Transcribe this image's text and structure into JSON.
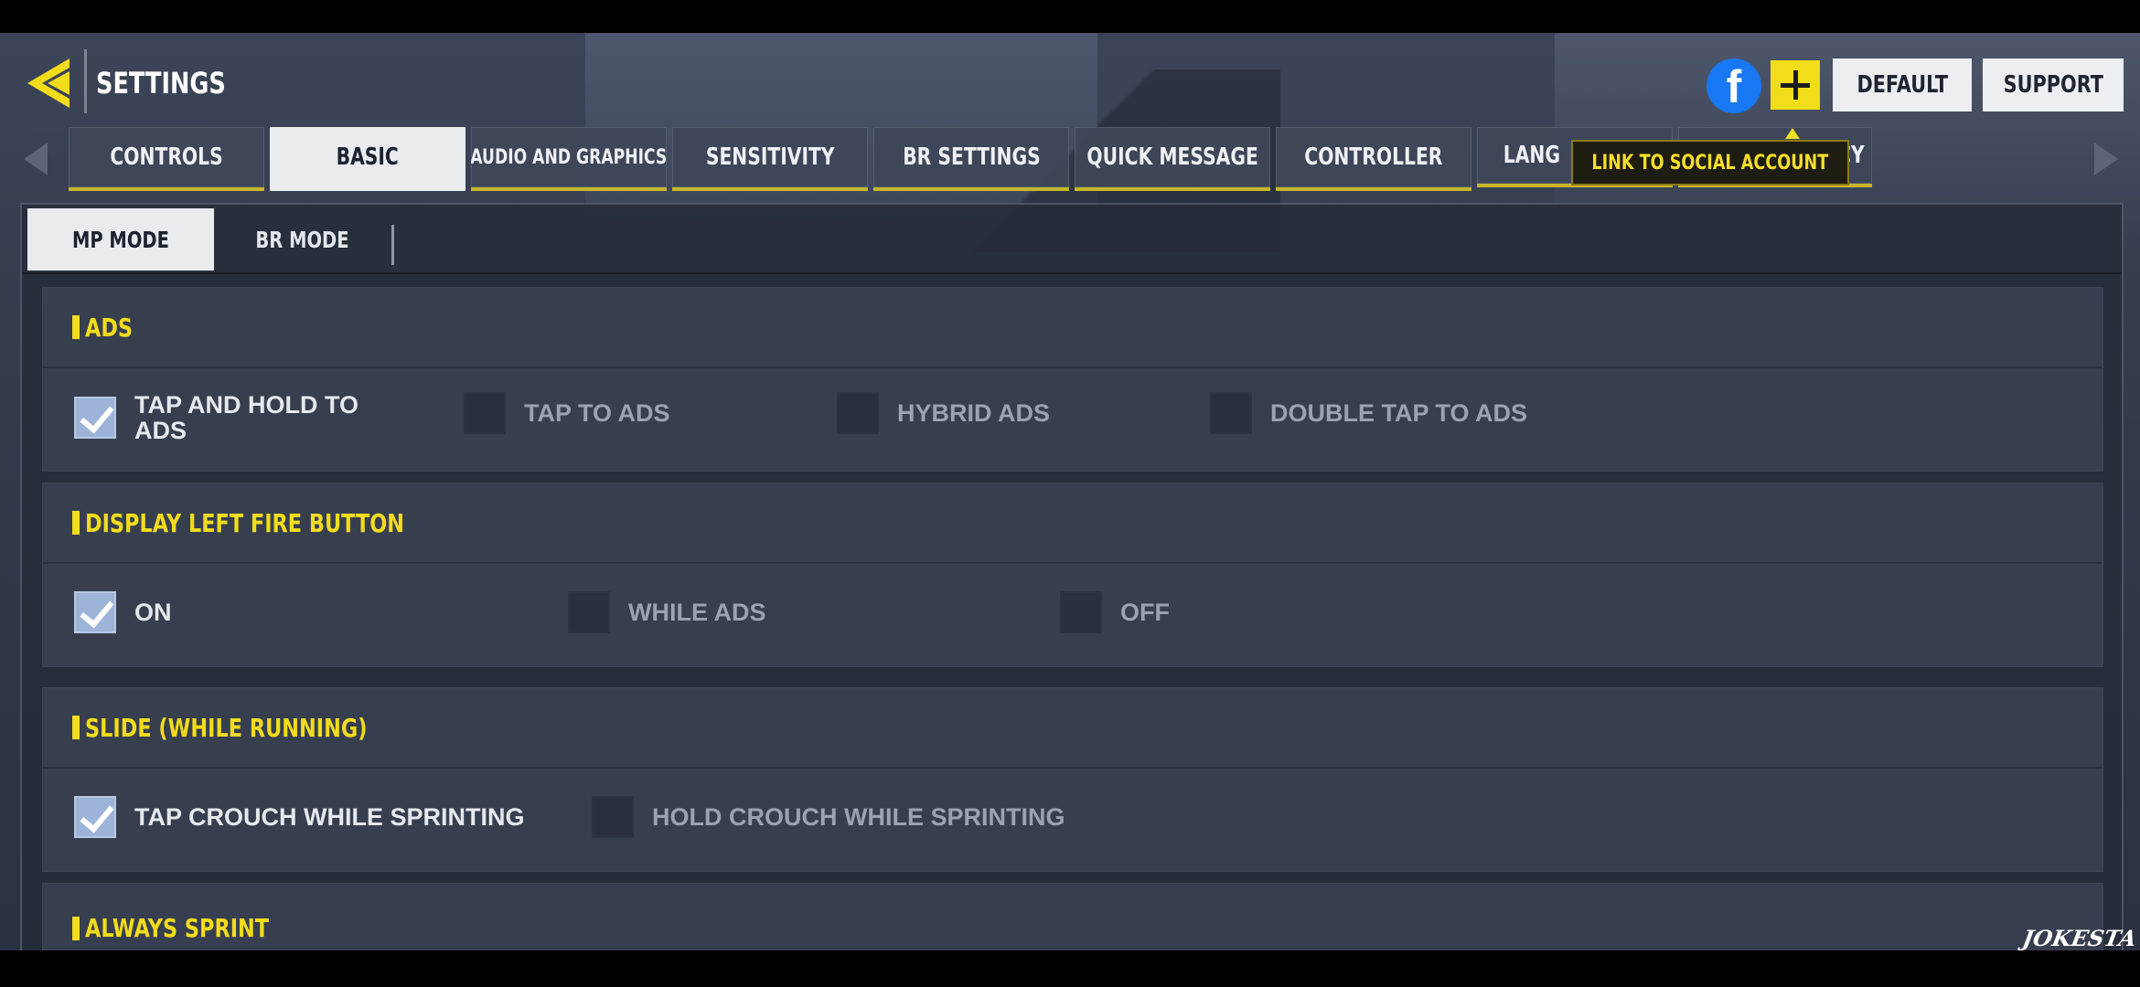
{
  "header": {
    "title": "SETTINGS",
    "back_icon": "back-chevron-icon",
    "facebook_icon": "facebook-icon",
    "facebook_glyph": "f",
    "add_icon": "plus-icon",
    "default_label": "DEFAULT",
    "support_label": "SUPPORT"
  },
  "tooltip": {
    "text": "LINK TO SOCIAL ACCOUNT"
  },
  "tabs": [
    {
      "label": "CONTROLS",
      "active": false
    },
    {
      "label": "BASIC",
      "active": true
    },
    {
      "label": "AUDIO AND GRAPHICS",
      "active": false
    },
    {
      "label": "SENSITIVITY",
      "active": false
    },
    {
      "label": "BR SETTINGS",
      "active": false
    },
    {
      "label": "QUICK MESSAGE",
      "active": false
    },
    {
      "label": "CONTROLLER",
      "active": false
    },
    {
      "label": "LANG",
      "active": false
    },
    {
      "label": "ACY",
      "active": false
    }
  ],
  "subtabs": [
    {
      "label": "MP MODE",
      "active": true
    },
    {
      "label": "BR MODE",
      "active": false
    }
  ],
  "sections": [
    {
      "title": "ADS",
      "options": [
        {
          "label": "TAP AND HOLD TO ADS",
          "checked": true
        },
        {
          "label": "TAP TO ADS",
          "checked": false
        },
        {
          "label": "HYBRID ADS",
          "checked": false
        },
        {
          "label": "DOUBLE TAP TO ADS",
          "checked": false
        }
      ]
    },
    {
      "title": "DISPLAY LEFT FIRE BUTTON",
      "options": [
        {
          "label": "ON",
          "checked": true
        },
        {
          "label": "WHILE ADS",
          "checked": false
        },
        {
          "label": "OFF",
          "checked": false
        }
      ]
    },
    {
      "title": "SLIDE (WHILE RUNNING)",
      "options": [
        {
          "label": "TAP CROUCH WHILE SPRINTING",
          "checked": true
        },
        {
          "label": "HOLD CROUCH WHILE SPRINTING",
          "checked": false
        }
      ]
    },
    {
      "title": "ALWAYS SPRINT",
      "options": []
    }
  ],
  "watermark": "JOKESTA",
  "colors": {
    "accent_yellow": "#f2dc1c",
    "checkbox_checked": "#9db4d8",
    "facebook_blue": "#1877f2"
  }
}
